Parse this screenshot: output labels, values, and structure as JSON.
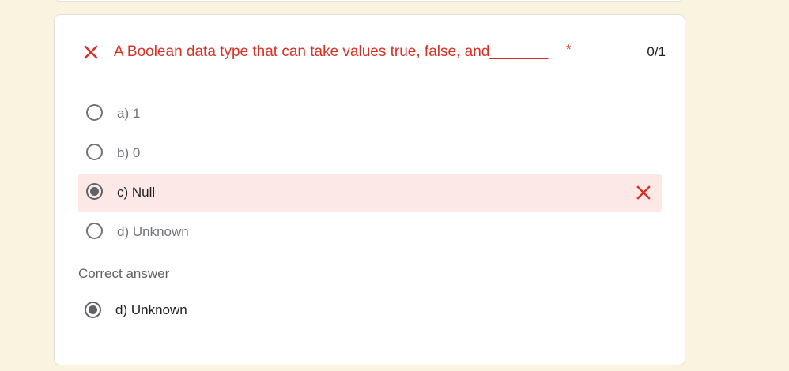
{
  "question": {
    "title": "A Boolean data type that can take values true, false, and_______",
    "required_marker": "*",
    "score": "0/1",
    "status_icon": "close-icon",
    "status_color": "#d93025"
  },
  "options": [
    {
      "label": "a) 1",
      "selected": false
    },
    {
      "label": "b) 0",
      "selected": false
    },
    {
      "label": "c) Null",
      "selected": true,
      "result": "incorrect"
    },
    {
      "label": "d) Unknown",
      "selected": false
    }
  ],
  "correct_answer": {
    "heading": "Correct answer",
    "label": "d) Unknown"
  },
  "colors": {
    "page_background": "#faf3df",
    "error": "#d93025",
    "wrong_highlight": "#fce8e6"
  }
}
